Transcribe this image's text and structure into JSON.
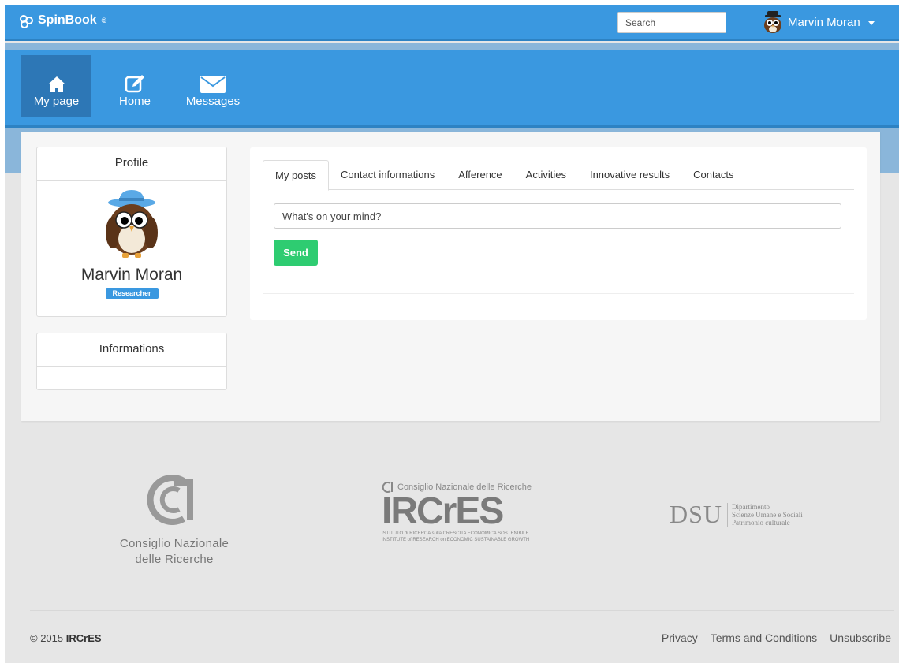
{
  "header": {
    "brand": "SpinBook",
    "brand_mark": "©",
    "search_placeholder": "Search",
    "user_name": "Marvin Moran"
  },
  "nav": {
    "items": [
      {
        "label": "My page",
        "icon": "home-icon"
      },
      {
        "label": "Home",
        "icon": "edit-icon"
      },
      {
        "label": "Messages",
        "icon": "envelope-icon"
      }
    ]
  },
  "profile": {
    "title": "Profile",
    "name": "Marvin Moran",
    "role": "Researcher"
  },
  "informations": {
    "title": "Informations"
  },
  "feed": {
    "tabs": [
      "My posts",
      "Contact informations",
      "Afference",
      "Activities",
      "Innovative results",
      "Contacts"
    ],
    "post_placeholder": "What's on your mind?",
    "send_label": "Send"
  },
  "logos": {
    "cnr": {
      "line1": "Consiglio Nazionale",
      "line2": "delle Ricerche"
    },
    "ircres": {
      "top": "Consiglio Nazionale delle Ricerche",
      "name": "IRCrES",
      "line1": "ISTITUTO di RICERCA sulla CRESCITA ECONOMICA SOSTENIBILE",
      "line2": "INSTITUTE of RESEARCH on ECONOMIC SUSTAINABLE GROWTH"
    },
    "dsu": {
      "name": "DSU",
      "line1": "Dipartimento",
      "line2": "Scienze Umane e Sociali",
      "line3": "Patrimonio culturale"
    }
  },
  "footer": {
    "copyright_prefix": "© 2015",
    "copyright_org": "IRCrES",
    "links": [
      "Privacy",
      "Terms and Conditions",
      "Unsubscribe"
    ]
  },
  "colors": {
    "primary": "#3a98e0",
    "active_nav": "#2d77b6",
    "send": "#2ecc71",
    "badge": "#3a98e0"
  }
}
